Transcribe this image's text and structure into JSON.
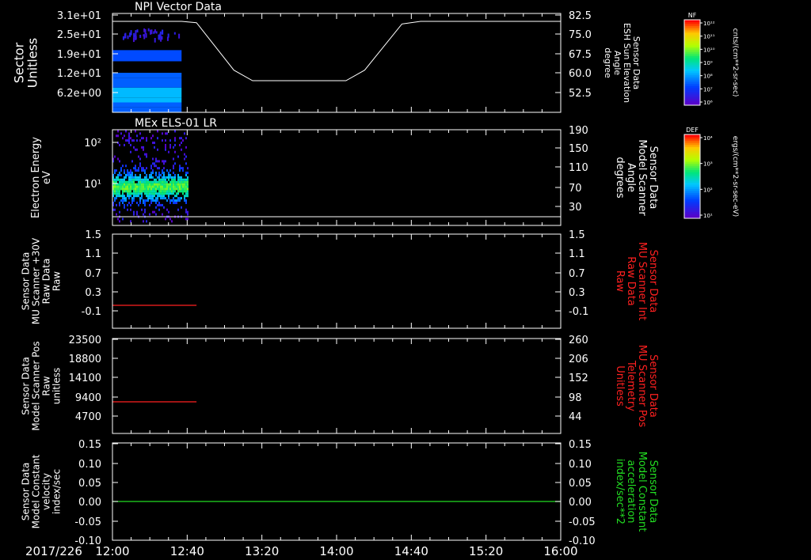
{
  "colors": {
    "axes": "#ffffff",
    "red": "#ff2020",
    "green": "#22dd22",
    "background": "#000000"
  },
  "time_axis": {
    "date_label": "2017/226",
    "tick_labels": [
      "12:00",
      "12:40",
      "13:20",
      "14:00",
      "14:40",
      "15:20",
      "16:00"
    ],
    "range": [
      "12:00",
      "16:00"
    ]
  },
  "panels": [
    {
      "id": "sector",
      "title": "NPI Vector Data",
      "left_label": [
        "Sector",
        "Unitless"
      ],
      "left_ticks": [
        "3.1e+01",
        "2.5e+01",
        "1.9e+01",
        "1.2e+01",
        "6.2e+00"
      ],
      "right_label": [
        "Sensor Data",
        "ESH Sun Elevation",
        "Angle",
        "degree"
      ],
      "right_ticks": [
        "82.5",
        "75.0",
        "67.5",
        "60.0",
        "52.5"
      ],
      "colorbar": {
        "title": "NF",
        "units": "cnts/(cm**2-sr-sec)",
        "ticks": [
          "10¹²",
          "10¹¹",
          "10¹⁰",
          "10⁹",
          "10⁸",
          "10⁷",
          "10⁶"
        ]
      }
    },
    {
      "id": "electron",
      "title": "MEx ELS-01 LR",
      "left_label": [
        "Electron Energy",
        "eV"
      ],
      "left_ticks": [
        "10²",
        "10¹"
      ],
      "right_label": [
        "Sensor Data",
        "Model Scanner",
        "Angle",
        "degrees"
      ],
      "right_ticks": [
        "190",
        "150",
        "110",
        "70",
        "30"
      ],
      "colorbar": {
        "title": "DEF",
        "units": "ergs/(cm**2-sr-sec-eV)",
        "ticks": [
          "10⁴",
          "10³",
          "10²",
          "10¹"
        ]
      }
    },
    {
      "id": "mu30",
      "left_label": [
        "Sensor Data",
        "MU Scanner +30V",
        "Raw Data",
        "Raw"
      ],
      "left_ticks": [
        "1.5",
        "1.1",
        "0.7",
        "0.3",
        "-0.1"
      ],
      "right_label": [
        "Sensor Data",
        "MU Scanner Int",
        "Raw Data",
        "Raw"
      ],
      "right_ticks": [
        "1.5",
        "1.1",
        "0.7",
        "0.3",
        "-0.1"
      ]
    },
    {
      "id": "scanpos",
      "left_label": [
        "Sensor Data",
        "Model Scanner Pos",
        "Raw",
        "unitless"
      ],
      "left_ticks": [
        "23500",
        "18800",
        "14100",
        "9400",
        "4700"
      ],
      "right_label": [
        "Sensor Data",
        "MU Scanner Pos",
        "Telemetry",
        "Unitless"
      ],
      "right_ticks": [
        "260",
        "206",
        "152",
        "98",
        "44"
      ]
    },
    {
      "id": "velocity",
      "left_label": [
        "Sensor Data",
        "Model Constant",
        "velocity",
        "index/sec"
      ],
      "left_ticks": [
        "0.15",
        "0.10",
        "0.05",
        "0.00",
        "-0.05",
        "-0.10"
      ],
      "right_label": [
        "Sensor Data",
        "Model Constant",
        "acceleration",
        "index/sec**2"
      ],
      "right_ticks": [
        "0.15",
        "0.10",
        "0.05",
        "0.00",
        "-0.05",
        "-0.10"
      ]
    }
  ],
  "chart_data": [
    {
      "type": "heatmap",
      "title": "NPI Vector Data",
      "ylabel": "Sector Unitless",
      "ylim": [
        0,
        31
      ],
      "x_range": [
        "12:00",
        "12:37"
      ],
      "note_rows": [
        {
          "sector_range": [
            0,
            12.4
          ],
          "level": "10⁸–10⁹"
        },
        {
          "sector_range": [
            16,
            19.5
          ],
          "level": "10⁹"
        },
        {
          "sector_range": [
            23,
            26
          ],
          "level": "10⁶–10⁷"
        }
      ],
      "overlay": {
        "name": "ESH Sun Elevation Angle",
        "units": "degree",
        "ylim": [
          45,
          82.5
        ],
        "x": [
          "12:00",
          "12:37",
          "12:45",
          "13:05",
          "13:15",
          "14:05",
          "14:15",
          "14:35",
          "14:45",
          "16:00"
        ],
        "y": [
          82.5,
          82.5,
          82.0,
          64.0,
          60.0,
          60.0,
          64.0,
          81.5,
          82.5,
          82.5
        ]
      }
    },
    {
      "type": "heatmap",
      "title": "MEx ELS-01 LR",
      "ylabel": "Electron Energy eV",
      "y_scale": "log",
      "ylim": [
        1,
        200
      ],
      "x_range": [
        "12:00",
        "12:40"
      ],
      "peak_energy_eV": 8,
      "overlay": {
        "name": "Model Scanner Angle",
        "units": "degrees",
        "ylim": [
          10,
          190
        ],
        "x": [
          "12:00",
          "16:00"
        ],
        "y": [
          10,
          10
        ]
      }
    },
    {
      "type": "line",
      "ylim": [
        -0.3,
        1.5
      ],
      "series": [
        {
          "x": [
            "12:00",
            "12:45"
          ],
          "y": [
            0.0,
            0.0
          ]
        }
      ]
    },
    {
      "type": "line",
      "ylim": [
        0,
        23500
      ],
      "series": [
        {
          "x": [
            "12:00",
            "12:45"
          ],
          "y": [
            8400,
            8400
          ]
        }
      ]
    },
    {
      "type": "line",
      "ylim": [
        -0.1,
        0.15
      ],
      "series": [
        {
          "x": [
            "12:00",
            "16:00"
          ],
          "y": [
            0.0,
            0.0
          ]
        }
      ]
    }
  ]
}
